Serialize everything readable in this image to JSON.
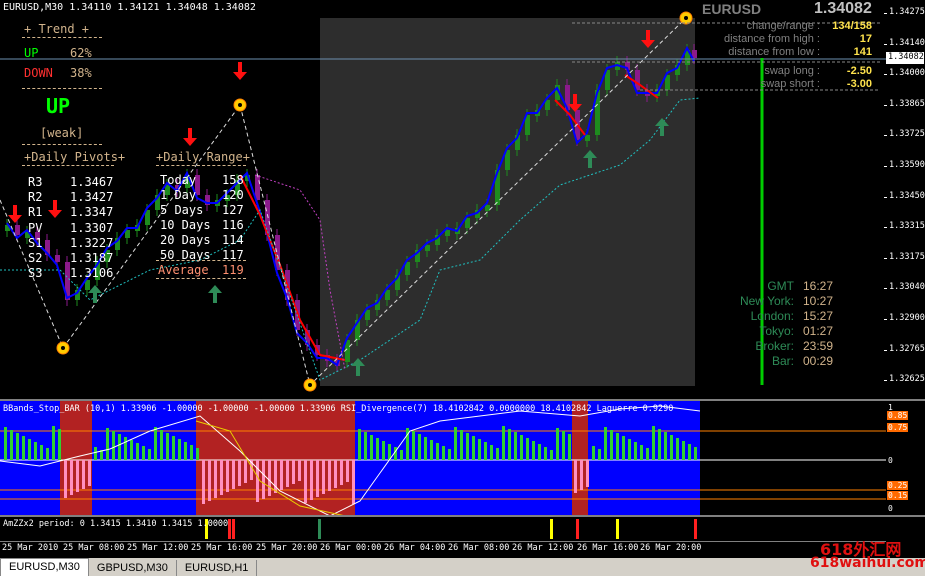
{
  "window": {
    "title": "EURUSD,M30",
    "ohlc": "1.34110 1.34121 1.34048 1.34082"
  },
  "trend_panel": {
    "header": "+ Trend +",
    "up_label": "UP",
    "up_pct": "62%",
    "down_label": "DOWN",
    "down_pct": "38%",
    "direction": "UP",
    "strength": "[weak]"
  },
  "pivots": {
    "header": "+Daily Pivots+",
    "rows": [
      {
        "label": "R3",
        "value": "1.3467"
      },
      {
        "label": "R2",
        "value": "1.3427"
      },
      {
        "label": "R1",
        "value": "1.3347"
      },
      {
        "label": "PV",
        "value": "1.3307"
      },
      {
        "label": "S1",
        "value": "1.3227"
      },
      {
        "label": "S2",
        "value": "1.3187"
      },
      {
        "label": "S3",
        "value": "1.3106"
      }
    ]
  },
  "daily_range": {
    "header": "+Daily Range+",
    "rows": [
      {
        "label": "Today",
        "value": "158"
      },
      {
        "label": "1 Day",
        "value": "120"
      },
      {
        "label": "5 Days",
        "value": "127"
      },
      {
        "label": "10 Days",
        "value": "116"
      },
      {
        "label": "20 Days",
        "value": "114"
      },
      {
        "label": "50 Days",
        "value": "117"
      }
    ],
    "average_label": "Average",
    "average_value": "119"
  },
  "symbol_info": {
    "symbol": "EURUSD",
    "price": "1.34082",
    "rows": [
      {
        "label": "change/range :",
        "value": "134/158"
      },
      {
        "label": "distance from high :",
        "value": "17"
      },
      {
        "label": "distance from low :",
        "value": "141"
      },
      {
        "label": "swap long :",
        "value": "-2.50"
      },
      {
        "label": "swap short :",
        "value": "-3.00"
      }
    ]
  },
  "clocks": [
    {
      "label": "GMT",
      "value": "16:27"
    },
    {
      "label": "New York:",
      "value": "10:27"
    },
    {
      "label": "London:",
      "value": "15:27"
    },
    {
      "label": "Tokyo:",
      "value": "01:27"
    },
    {
      "label": "Broker:",
      "value": "23:59"
    },
    {
      "label": "Bar:",
      "value": "00:29"
    }
  ],
  "price_scale": {
    "current": "1.34082",
    "ticks": [
      "1.34275",
      "1.34140",
      "1.34000",
      "1.33865",
      "1.33725",
      "1.33590",
      "1.33450",
      "1.33315",
      "1.33175",
      "1.33040",
      "1.32900",
      "1.32765",
      "1.32625"
    ]
  },
  "indicator1": {
    "caption": "BBands_Stop_BAR (10,1) 1.33906 -1.00000 -1.00000 -1.00000 1.33906 RSI_Divergence(7) 18.4102842 0.0000000 18.4102842 Laguerre 0.9290",
    "scale": [
      "1",
      "0.85",
      "0.75",
      "0",
      "0.25",
      "0.15",
      "0"
    ]
  },
  "indicator2": {
    "caption": "AmZZx2 period: 0 1.3415 1.3410 1.3415 1.0000"
  },
  "time_axis": [
    "25 Mar 2010",
    "25 Mar 08:00",
    "25 Mar 12:00",
    "25 Mar 16:00",
    "25 Mar 20:00",
    "26 Mar 00:00",
    "26 Mar 04:00",
    "26 Mar 08:00",
    "26 Mar 12:00",
    "26 Mar 16:00",
    "26 Mar 20:00"
  ],
  "tabs": [
    {
      "label": "EURUSD,M30",
      "active": true
    },
    {
      "label": "GBPUSD,M30",
      "active": false
    },
    {
      "label": "EURUSD,H1",
      "active": false
    }
  ],
  "watermark": {
    "line1": "618外汇网",
    "line2": "618waihui.com"
  },
  "colors": {
    "bull": "#1e8c1e",
    "bear": "#8b1a8b",
    "trend_up": "#0000ff",
    "trend_down": "#ff0000",
    "osc_bg_up": "#0000ff",
    "osc_bg_down": "#b22222",
    "label_text": "#d2b48c",
    "trend_up_text": "#00ff00",
    "down_text": "#ff3030"
  }
}
